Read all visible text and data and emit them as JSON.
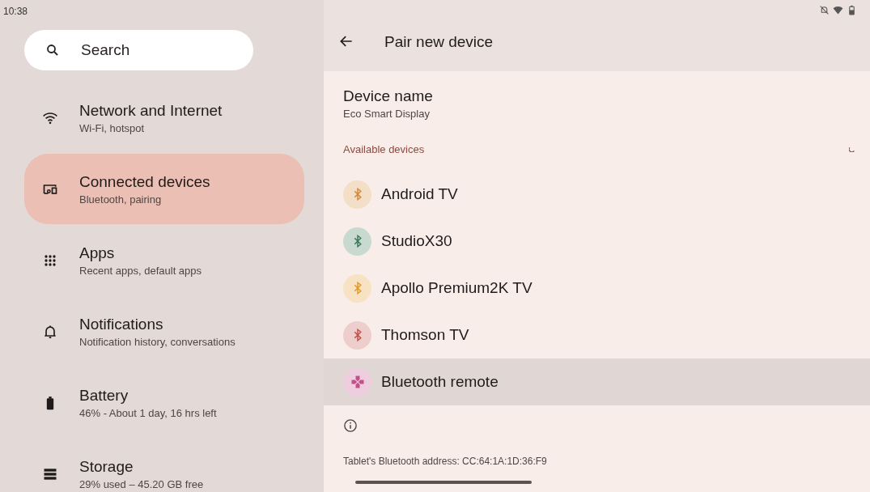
{
  "status_bar": {
    "time": "10:38"
  },
  "search": {
    "placeholder": "Search"
  },
  "sidebar": {
    "items": [
      {
        "kind": "wifi",
        "title": "Network and Internet",
        "subtitle": "Wi-Fi, hotspot",
        "selected": false
      },
      {
        "kind": "devices",
        "title": "Connected devices",
        "subtitle": "Bluetooth, pairing",
        "selected": true
      },
      {
        "kind": "apps",
        "title": "Apps",
        "subtitle": "Recent apps, default apps",
        "selected": false
      },
      {
        "kind": "bell",
        "title": "Notifications",
        "subtitle": "Notification history, conversations",
        "selected": false
      },
      {
        "kind": "battery",
        "title": "Battery",
        "subtitle": "46% - About 1 day, 16 hrs left",
        "selected": false
      },
      {
        "kind": "storage",
        "title": "Storage",
        "subtitle": "29% used – 45.20 GB free",
        "selected": false
      }
    ]
  },
  "page": {
    "title": "Pair new device",
    "device_name": {
      "label": "Device name",
      "value": "Eco Smart Display"
    },
    "section_title": "Available devices",
    "devices": [
      {
        "kind": "bluetooth",
        "name": "Android TV",
        "color": "#d48a3a",
        "selected": false
      },
      {
        "kind": "bluetooth",
        "name": "StudioX30",
        "color": "#3a7a58",
        "selected": false
      },
      {
        "kind": "bluetooth",
        "name": "Apollo Premium2K TV",
        "color": "#e39a2c",
        "selected": false
      },
      {
        "kind": "bluetooth",
        "name": "Thomson TV",
        "color": "#c2504a",
        "selected": false
      },
      {
        "kind": "gamepad",
        "name": "Bluetooth remote",
        "color": "#c4508a",
        "selected": true
      }
    ],
    "footer": "Tablet's Bluetooth address: CC:64:1A:1D:36:F9"
  }
}
